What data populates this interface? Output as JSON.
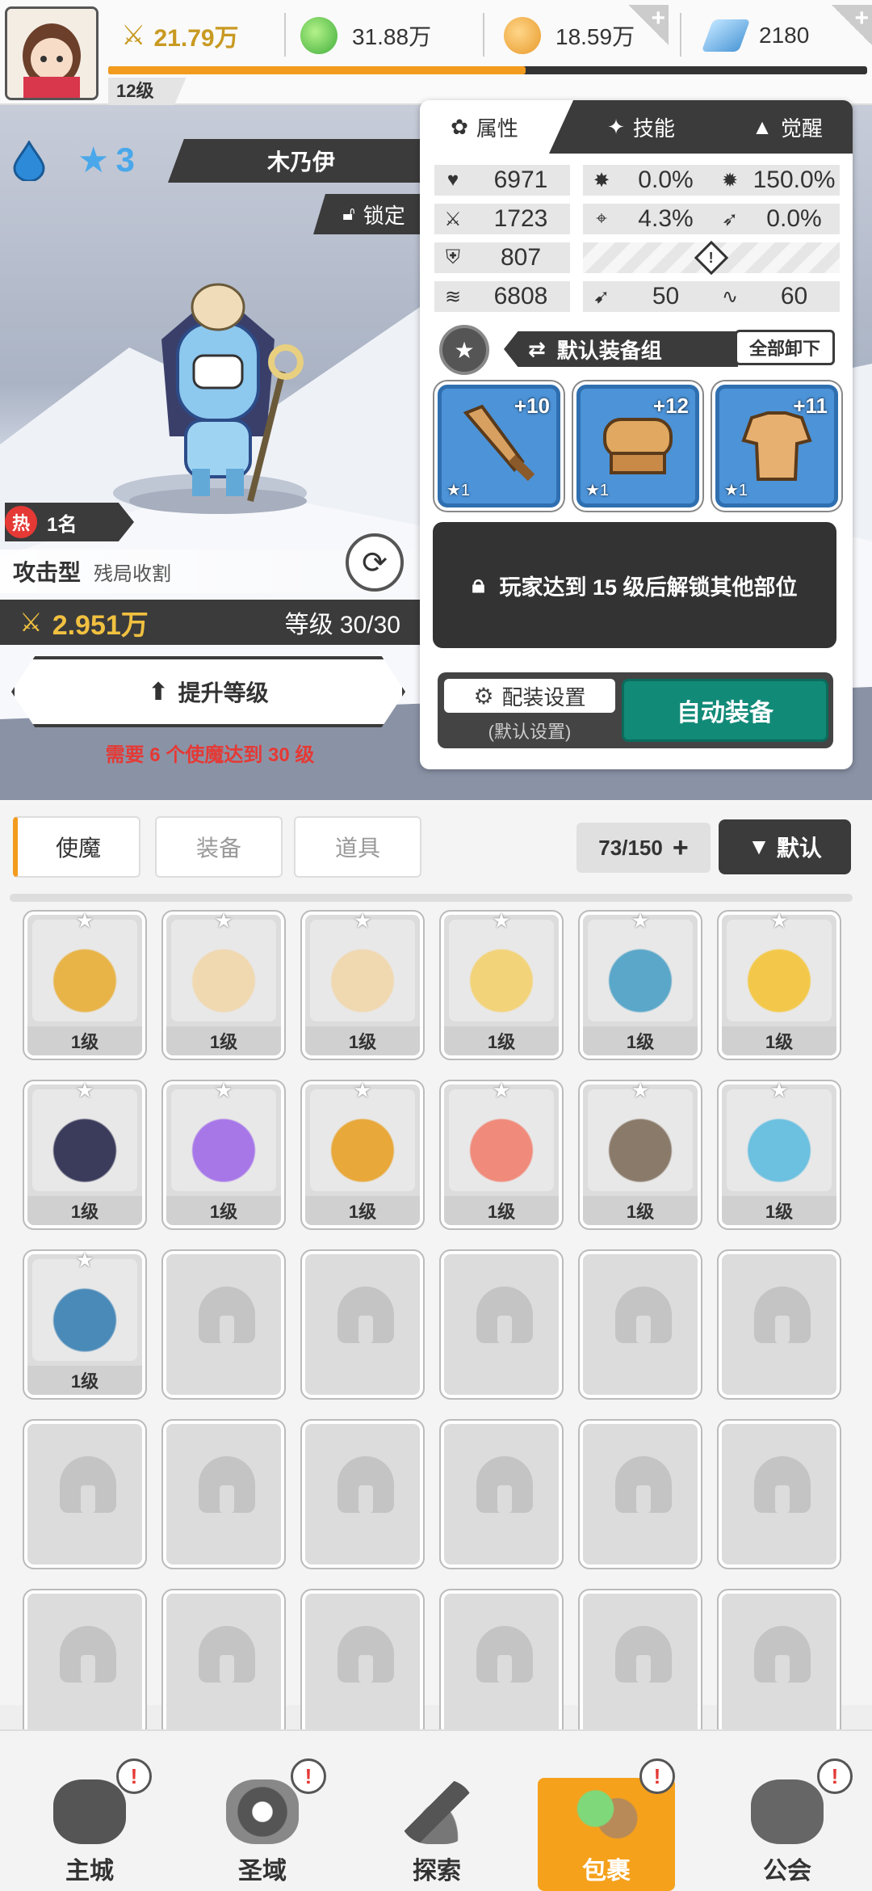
{
  "topbar": {
    "power_value": "21.79万",
    "green_currency": "31.88万",
    "orange_currency": "18.59万",
    "gem_count": "2180",
    "player_level": "12级",
    "xp_progress": 0.55
  },
  "hero": {
    "element_icon": "water-drop-icon",
    "stars": "3",
    "name": "木乃伊",
    "lock_label": "锁定",
    "rank_badge": "热",
    "rank_text": "1名",
    "type": "攻击型",
    "trait": "残局收割",
    "power": "2.951万",
    "level_text": "等级 30/30",
    "upgrade_label": "提升等级",
    "requirement": "需要 6 个使魔达到 30 级"
  },
  "panel": {
    "tabs": [
      "属性",
      "技能",
      "觉醒"
    ],
    "stats_left": [
      "6971",
      "1723",
      "807",
      "6808"
    ],
    "stats_right": [
      [
        "0.0%",
        "150.0%"
      ],
      [
        "4.3%",
        "0.0%"
      ],
      [
        "50",
        "60"
      ]
    ],
    "equip_set_label": "默认装备组",
    "unequip_all": "全部卸下",
    "equipment": [
      {
        "icon": "sword-icon",
        "plus": "+10",
        "star": "★1"
      },
      {
        "icon": "helmet-icon",
        "plus": "+12",
        "star": "★1"
      },
      {
        "icon": "armor-icon",
        "plus": "+11",
        "star": "★1"
      }
    ],
    "locked_slots_text": "玩家达到 15 级后解锁其他部位",
    "config_label": "配装设置",
    "config_sub": "(默认设置)",
    "auto_equip": "自动装备"
  },
  "inventory": {
    "tabs": [
      "使魔",
      "装备",
      "道具"
    ],
    "count": "73/150",
    "sort_label": "默认",
    "items": [
      {
        "level": "1级",
        "color": "#e8b448"
      },
      {
        "level": "1级",
        "color": "#f0d8b0"
      },
      {
        "level": "1级",
        "color": "#f0d8b0"
      },
      {
        "level": "1级",
        "color": "#f3d37a"
      },
      {
        "level": "1级",
        "color": "#5ba7c9"
      },
      {
        "level": "1级",
        "color": "#f3c84a"
      },
      {
        "level": "1级",
        "color": "#3b3b5c"
      },
      {
        "level": "1级",
        "color": "#a777e8"
      },
      {
        "level": "1级",
        "color": "#e8a83a"
      },
      {
        "level": "1级",
        "color": "#f08a7a"
      },
      {
        "level": "1级",
        "color": "#8a7a6a"
      },
      {
        "level": "1级",
        "color": "#6cc0e0"
      },
      {
        "level": "1级",
        "color": "#4a8ab8"
      }
    ]
  },
  "nav": {
    "items": [
      "主城",
      "圣域",
      "探索",
      "包裹",
      "公会"
    ],
    "badge": "!"
  }
}
